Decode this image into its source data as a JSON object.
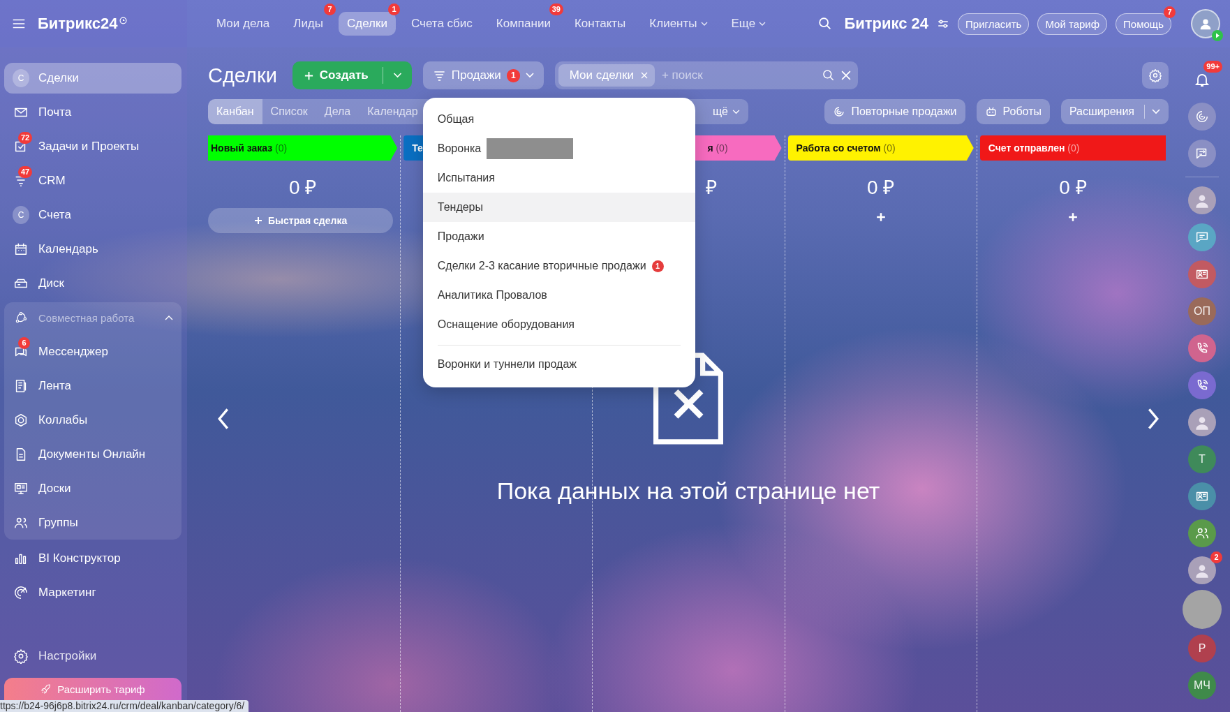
{
  "topbar": {
    "logo": "Битрикс24",
    "nav": [
      {
        "label": "Мои дела",
        "selected": false
      },
      {
        "label": "Лиды",
        "badge": "7",
        "selected": false
      },
      {
        "label": "Сделки",
        "badge": "1",
        "selected": true
      },
      {
        "label": "Счета сбис",
        "selected": false
      },
      {
        "label": "Компании",
        "badge": "39",
        "selected": false
      },
      {
        "label": "Контакты",
        "selected": false
      },
      {
        "label": "Клиенты",
        "dropdown": true,
        "selected": false
      },
      {
        "label": "Еще",
        "dropdown": true,
        "selected": false
      }
    ],
    "brand": "Битрикс 24",
    "actions": [
      {
        "label": "Пригласить"
      },
      {
        "label": "Мой тариф"
      },
      {
        "label": "Помощь",
        "badge": "7"
      }
    ]
  },
  "sidebar": {
    "items": [
      {
        "label": "Сделки",
        "initial": "С",
        "selected": true
      },
      {
        "label": "Почта",
        "selected": false
      },
      {
        "label": "Задачи и Проекты",
        "badge": "72",
        "selected": false
      },
      {
        "label": "CRM",
        "badge": "47",
        "selected": false
      },
      {
        "label": "Счета",
        "initial": "С",
        "selected": false
      },
      {
        "label": "Календарь",
        "selected": false
      },
      {
        "label": "Диск",
        "selected": false
      }
    ],
    "group": {
      "label": "Совместная работа",
      "expanded": true,
      "children": [
        {
          "label": "Мессенджер",
          "badge": "6",
          "selected": false
        },
        {
          "label": "Лента",
          "selected": false
        },
        {
          "label": "Коллабы",
          "selected": false
        },
        {
          "label": "Документы Онлайн",
          "selected": false
        },
        {
          "label": "Доски",
          "selected": false
        },
        {
          "label": "Группы",
          "selected": false
        }
      ]
    },
    "more_items": [
      {
        "label": "BI Конструктор",
        "selected": false
      },
      {
        "label": "Маркетинг",
        "selected": false
      }
    ],
    "settings": "Настройки",
    "upgrade_button": "Расширить тариф"
  },
  "page": {
    "title": "Сделки",
    "create_button": "Создать",
    "filter": {
      "label": "Продажи",
      "badge": "1"
    },
    "search": {
      "chip": "Мои сделки",
      "placeholder": "+ поиск"
    }
  },
  "view_tabs": [
    {
      "label": "Канбан",
      "selected": true
    },
    {
      "label": "Список",
      "selected": false
    },
    {
      "label": "Дела",
      "selected": false
    },
    {
      "label": "Календар",
      "selected": false
    }
  ],
  "view_more": "щё",
  "toolbar_buttons": [
    {
      "label": "Повторные продажи"
    },
    {
      "label": "Роботы"
    },
    {
      "label": "Расширения",
      "dropdown": true
    }
  ],
  "pipeline_menu": {
    "items": [
      {
        "label": "Общая",
        "highlighted": false
      },
      {
        "label": "Воронка",
        "redacted": true,
        "highlighted": false
      },
      {
        "label": "Испытания",
        "highlighted": false
      },
      {
        "label": "Тендеры",
        "highlighted": true
      },
      {
        "label": "Продажи",
        "highlighted": false
      },
      {
        "label": "Сделки 2-3 касание вторичные продажи",
        "badge": "1",
        "highlighted": false
      },
      {
        "label": "Аналитика Провалов",
        "highlighted": false
      },
      {
        "label": "Оснащение оборудования",
        "highlighted": false
      }
    ],
    "footer": "Воронки и туннели продаж"
  },
  "columns": [
    {
      "title": "Новый заказ",
      "count": "(0)",
      "color": "#00ff00",
      "amount": "0 ₽",
      "clipped": false,
      "add": {
        "kind": "quick",
        "label": "Быстрая сделка"
      }
    },
    {
      "title": "Те",
      "color": "#0a6fc2",
      "clipped": false
    },
    {
      "title": "я",
      "count": "(0)",
      "color": "#f76bbf",
      "amount": "₽",
      "clipped": true
    },
    {
      "title": "Работа со счетом",
      "count": "(0)",
      "color": "#fff200",
      "amount": "0 ₽",
      "clipped": false,
      "add": {
        "kind": "plus"
      }
    },
    {
      "title": "Счет отправлен",
      "count": "(0)",
      "color": "#f01818",
      "amount": "0 ₽",
      "clipped": false,
      "add": {
        "kind": "plus"
      }
    }
  ],
  "empty_state": "Пока данных на этой странице нет",
  "right_panel": [
    {
      "kind": "bell",
      "badge": "99+"
    },
    {
      "kind": "icon",
      "color": "#8a8fc4"
    },
    {
      "kind": "icon",
      "color": "#8a8fc4"
    },
    {
      "kind": "photo"
    },
    {
      "kind": "icon",
      "color": "#5aa6c4"
    },
    {
      "kind": "icon",
      "color": "#c25a62"
    },
    {
      "kind": "initials",
      "text": "ОП",
      "color": "#9a6a5a"
    },
    {
      "kind": "icon",
      "color": "#d0648e"
    },
    {
      "kind": "icon",
      "color": "#7a6ad0"
    },
    {
      "kind": "photo"
    },
    {
      "kind": "initials",
      "text": "Т",
      "color": "#3f8a5a"
    },
    {
      "kind": "icon",
      "color": "#4a8fa8"
    },
    {
      "kind": "icon",
      "color": "#5a9a4a"
    },
    {
      "kind": "photo",
      "badge": "2"
    },
    {
      "kind": "initials",
      "text": "Р",
      "color": "#b0404e"
    },
    {
      "kind": "initials",
      "text": "МЧ",
      "color": "#3f8a4a"
    }
  ],
  "status_url": "ttps://b24-96j6p8.bitrix24.ru/crm/deal/kanban/category/6/"
}
